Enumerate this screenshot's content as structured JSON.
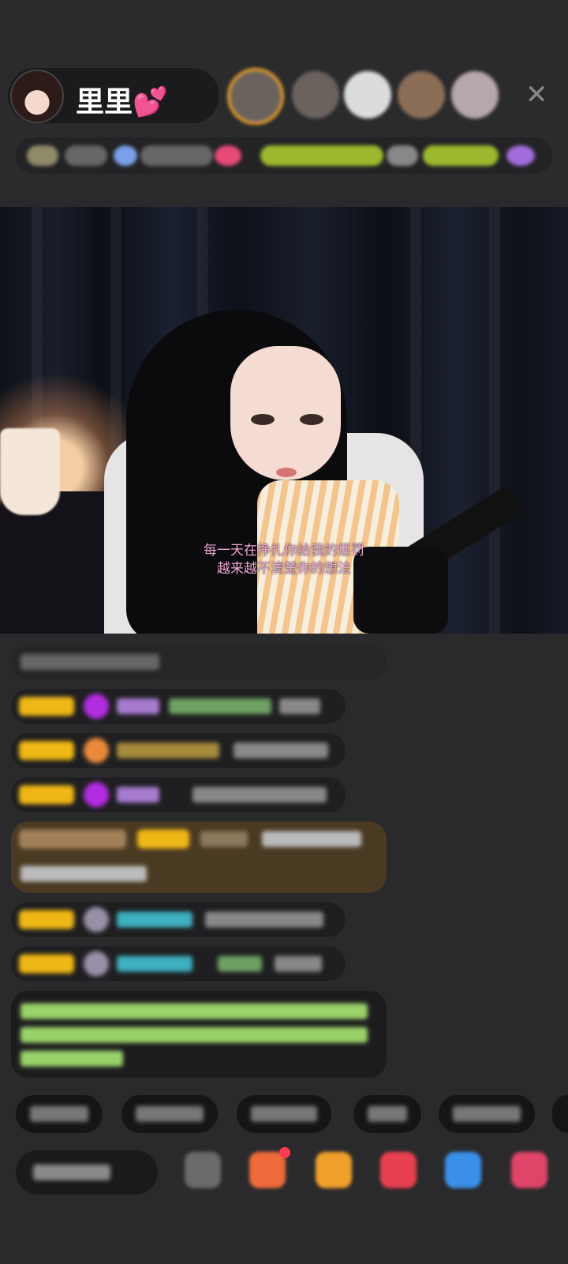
{
  "host": {
    "name": "里里💕"
  },
  "video": {
    "lyrics_line1": "每一天在挣扎你给我的惩罚",
    "lyrics_line2": "越来越不清楚你的想法"
  },
  "icons": {
    "close": "close-icon",
    "host_avatar": "avatar",
    "gift": "gift-icon"
  },
  "colors": {
    "accent_gold": "#f0b816",
    "lyrics_pink": "#f0a9d6",
    "chat_green": "#9ad36a"
  }
}
